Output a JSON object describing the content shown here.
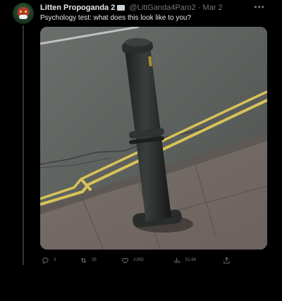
{
  "tweet": {
    "author_name": "Litten Propoganda 2",
    "author_handle": "@LittGanda4Paro2",
    "separator": "·",
    "date": "Mar 2",
    "more": "•••",
    "text": "Psychology test: what does this look like to you?",
    "media_alt": "Photo of a dark bollard on a pavement next to a road with double yellow lines"
  },
  "actions": {
    "replies": "3",
    "retweets": "39",
    "likes": "3,682",
    "views": "51.6K"
  },
  "colors": {
    "background": "#000000",
    "text_primary": "#e7e9ea",
    "text_secondary": "#71767b"
  },
  "icons": [
    "reply-icon",
    "retweet-icon",
    "like-icon",
    "views-icon",
    "share-icon",
    "verified-flag-icon",
    "more-icon"
  ]
}
